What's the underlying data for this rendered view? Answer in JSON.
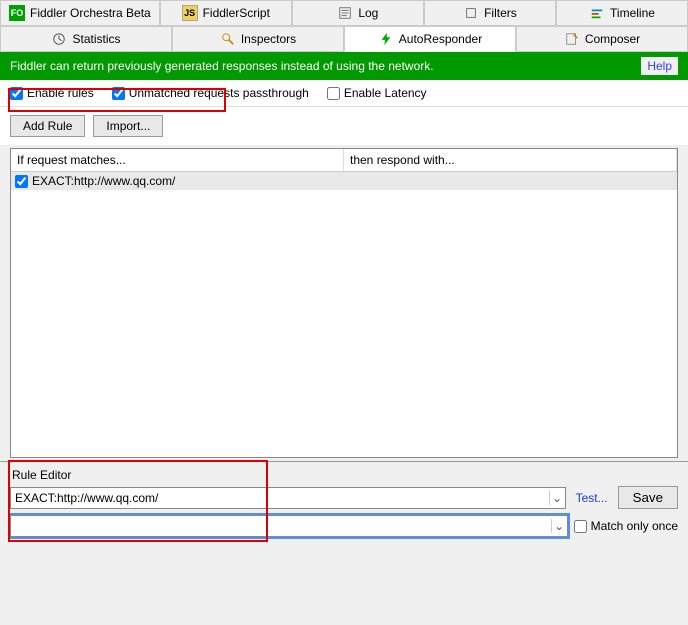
{
  "tabs_top": {
    "orchestra": "Fiddler Orchestra Beta",
    "script": "FiddlerScript",
    "log": "Log",
    "filters": "Filters",
    "timeline": "Timeline"
  },
  "tabs_bottom": {
    "statistics": "Statistics",
    "inspectors": "Inspectors",
    "autoresponder": "AutoResponder",
    "composer": "Composer"
  },
  "info_text": "Fiddler can return previously generated responses instead of using the network.",
  "help_label": "Help",
  "options": {
    "enable_rules": "Enable rules",
    "unmatched": "Unmatched requests passthrough",
    "latency": "Enable Latency"
  },
  "buttons": {
    "add_rule": "Add Rule",
    "import": "Import..."
  },
  "table": {
    "col_match": "If request matches...",
    "col_respond": "then respond with...",
    "rows": [
      {
        "match": "EXACT:http://www.qq.com/",
        "respond": ""
      }
    ]
  },
  "editor": {
    "title": "Rule Editor",
    "match_value": "EXACT:http://www.qq.com/",
    "respond_value": "",
    "test": "Test...",
    "save": "Save",
    "match_once": "Match only once"
  }
}
